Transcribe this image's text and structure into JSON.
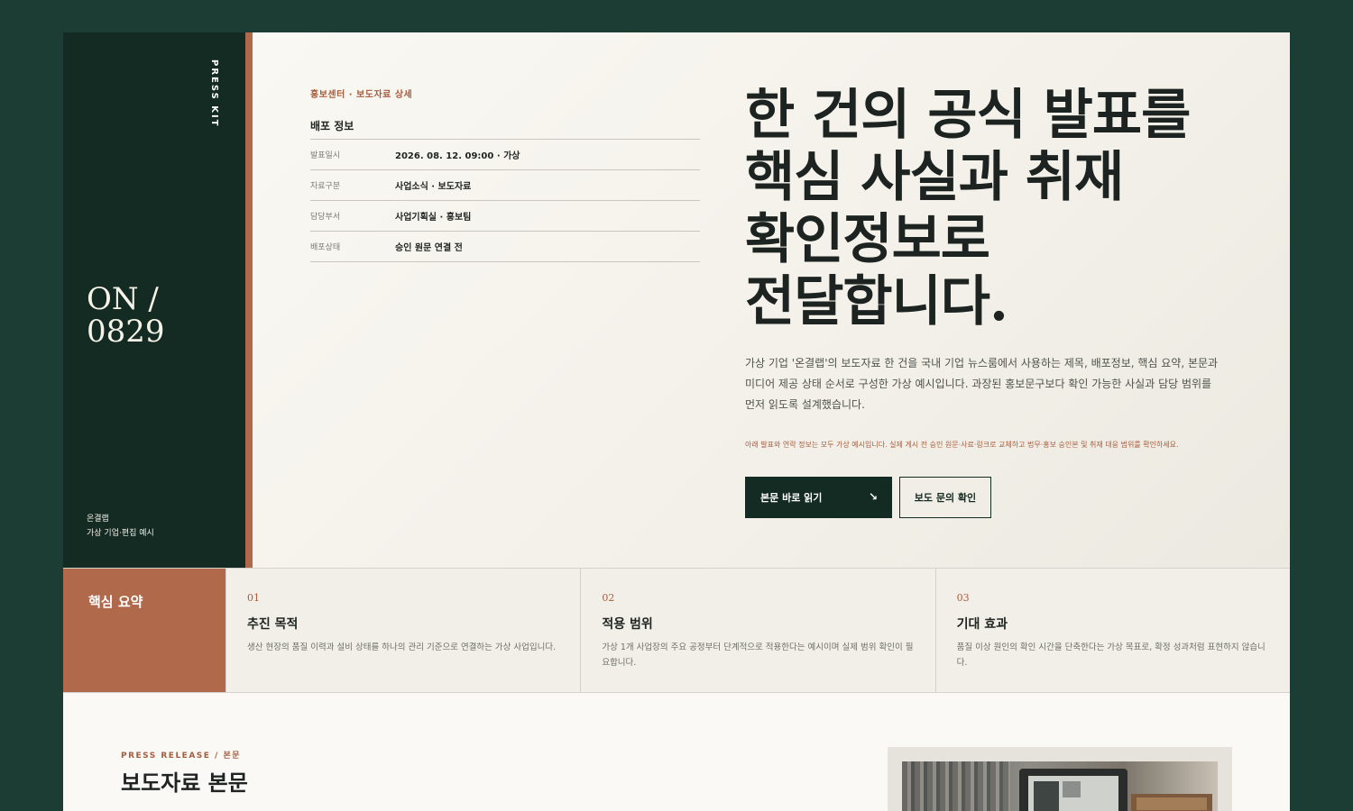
{
  "side": {
    "vertical_label": "PRESS KIT",
    "code_line1": "ON /",
    "code_line2": "0829",
    "brand_name": "온결랩",
    "brand_desc": "가상 기업·편집 예시"
  },
  "hero": {
    "breadcrumb": "홍보센터 · 보도자료 상세",
    "info_title": "배포 정보",
    "info_rows": [
      {
        "key": "발표일시",
        "value": "2026. 08. 12. 09:00 · 가상"
      },
      {
        "key": "자료구분",
        "value": "사업소식 · 보도자료"
      },
      {
        "key": "담당부서",
        "value": "사업기획실 · 홍보팀"
      },
      {
        "key": "배포상태",
        "value": "승인 원문 연결 전"
      }
    ],
    "headline_lines": [
      "한 건의 공식 발표를",
      "핵심 사실과 취재",
      "확인정보로",
      "전달합니다."
    ],
    "lead_lines": [
      "가상 기업 '온결랩'의 보도자료 한 건을 국내 기업 뉴스룸에서 사용하는 제목, 배포정보, 핵심 요약, 본문과",
      "미디어 제공 상태 순서로 구성한 가상 예시입니다. 과장된 홍보문구보다 확인 가능한 사실과 담당 범위를",
      "먼저 읽도록 설계했습니다."
    ],
    "note": "아래 발표와 연락 정보는 모두 가상 예시입니다. 실제 게시 전 승인 원문·사료·링크로 교체하고 법무·홍보 승인본 및 취재 대응 범위를 확인하세요.",
    "primary_button": "본문 바로 읽기",
    "primary_arrow": "↘",
    "secondary_button": "보도 문의 확인"
  },
  "summary": {
    "label": "핵심 요약",
    "items": [
      {
        "num": "01",
        "title": "추진 목적",
        "desc": "생산 현장의 품질 이력과 설비 상태를 하나의 관리 기준으로 연결하는 가상 사업입니다."
      },
      {
        "num": "02",
        "title": "적용 범위",
        "desc": "가상 1개 사업장의 주요 공정부터 단계적으로 적용한다는 예시이며 실제 범위 확인이 필요합니다."
      },
      {
        "num": "03",
        "title": "기대 효과",
        "desc": "품질 이상 원인의 확인 시간을 단축한다는 가상 목표로, 확정 성과처럼 표현하지 않습니다."
      }
    ]
  },
  "body": {
    "kicker": "PRESS RELEASE / 본문",
    "title": "보도자료 본문"
  },
  "icons": {
    "arrow": "arrow-down-right-icon"
  },
  "colors": {
    "dark_green": "#142b24",
    "accent": "#b0694a",
    "background": "#1b3d33"
  }
}
